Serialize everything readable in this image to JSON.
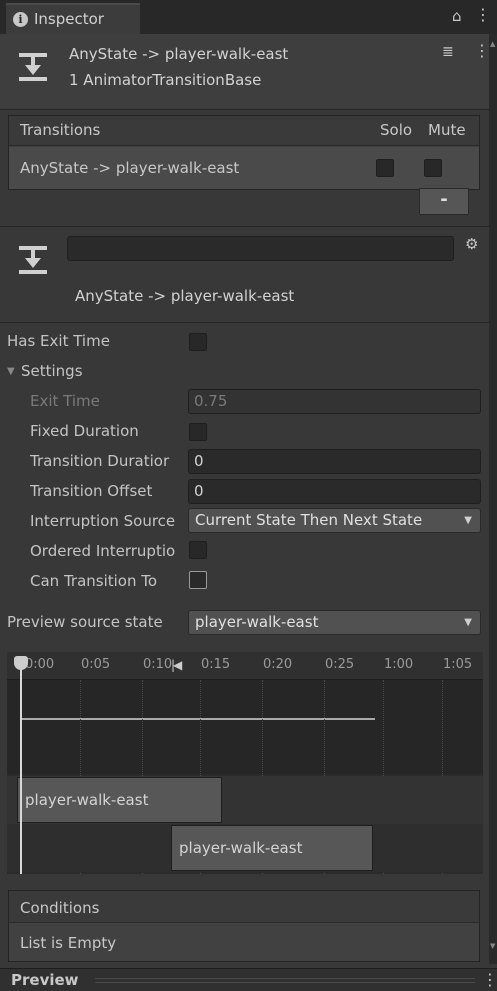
{
  "tab": {
    "icon": "info-icon",
    "title": "Inspector"
  },
  "header": {
    "icon": "transition-icon",
    "title": "AnyState -> player-walk-east",
    "subtitle": "1 AnimatorTransitionBase"
  },
  "transitions": {
    "header": "Transitions",
    "solo_label": "Solo",
    "mute_label": "Mute",
    "rows": [
      {
        "label": "AnyState -> player-walk-east",
        "solo": false,
        "mute": false
      }
    ],
    "remove_label": "-"
  },
  "transition": {
    "name_value": "",
    "title": "AnyState -> player-walk-east"
  },
  "settings": {
    "has_exit_time_label": "Has Exit Time",
    "has_exit_time": false,
    "section_label": "Settings",
    "exit_time_label": "Exit Time",
    "exit_time_value": "0.75",
    "fixed_duration_label": "Fixed Duration",
    "fixed_duration": false,
    "transition_duration_label": "Transition Duratior",
    "transition_duration_value": "0",
    "transition_offset_label": "Transition Offset",
    "transition_offset_value": "0",
    "interruption_source_label": "Interruption Source",
    "interruption_source_value": "Current State Then Next State",
    "ordered_interruption_label": "Ordered Interruptio",
    "ordered_interruption": false,
    "can_transition_label": "Can Transition To",
    "can_transition": false
  },
  "preview_source": {
    "label": "Preview source state",
    "value": "player-walk-east"
  },
  "timeline": {
    "ticks": [
      "0:00",
      "0:05",
      "0:10",
      "0:15",
      "0:20",
      "0:25",
      "1:00",
      "1:05"
    ],
    "clip_a": "player-walk-east",
    "clip_b": "player-walk-east"
  },
  "conditions": {
    "header": "Conditions",
    "empty_text": "List is Empty"
  },
  "preview": {
    "label": "Preview"
  }
}
